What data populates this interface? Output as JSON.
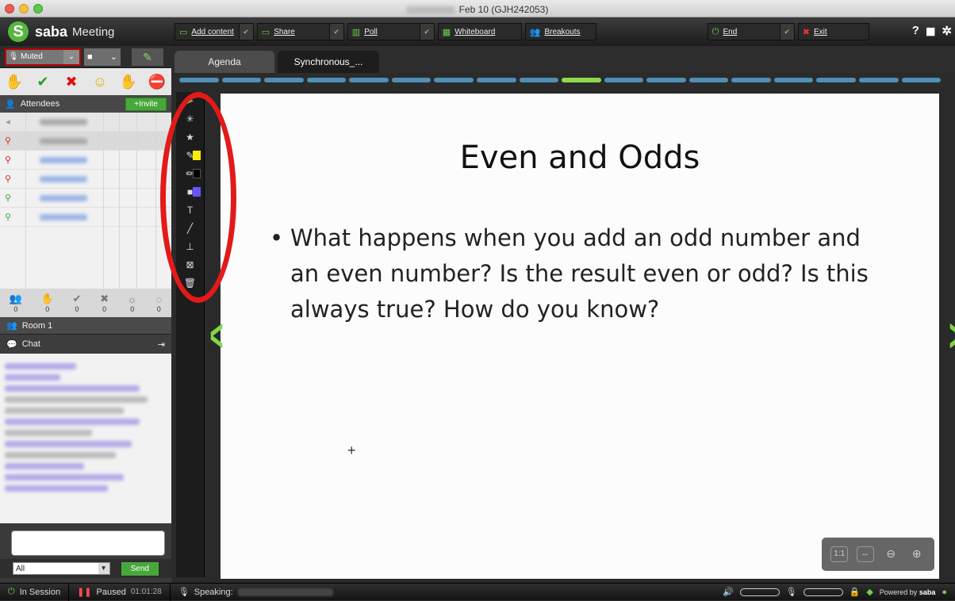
{
  "window": {
    "title": "Feb 10 (GJH242053)"
  },
  "logo": {
    "brand": "saba",
    "product": "Meeting",
    "s": "S"
  },
  "av": {
    "muted_label": "Muted"
  },
  "attendees": {
    "header": "Attendees",
    "invite_label": "+Invite"
  },
  "status_counts": [
    "0",
    "0",
    "0",
    "0",
    "0",
    "0"
  ],
  "room": {
    "label": "Room 1"
  },
  "chat": {
    "header": "Chat",
    "recipient": "All",
    "send_label": "Send"
  },
  "toolbar": {
    "add_content": "Add content",
    "share": "Share",
    "poll": "Poll",
    "whiteboard": "Whiteboard",
    "breakouts": "Breakouts",
    "end": "End",
    "exit": "Exit"
  },
  "tabs": [
    {
      "label": "Agenda"
    },
    {
      "label": "Synchronous_..."
    }
  ],
  "slide": {
    "title": "Even and Odds",
    "bullet": "What happens when you add an odd number and an even number?  Is the result even or odd? Is this always true?  How do you know?"
  },
  "zoom": {
    "fit_label": "1:1"
  },
  "status": {
    "in_session": "In Session",
    "paused": "Paused",
    "timer": "01:01:28",
    "speaking": "Speaking:",
    "powered_by": "Powered by",
    "powered_brand": "saba"
  },
  "colors": {
    "accent_green": "#6ece4e",
    "progress_blue": "#4e8fb5",
    "highlight_red": "#e31a1a"
  }
}
